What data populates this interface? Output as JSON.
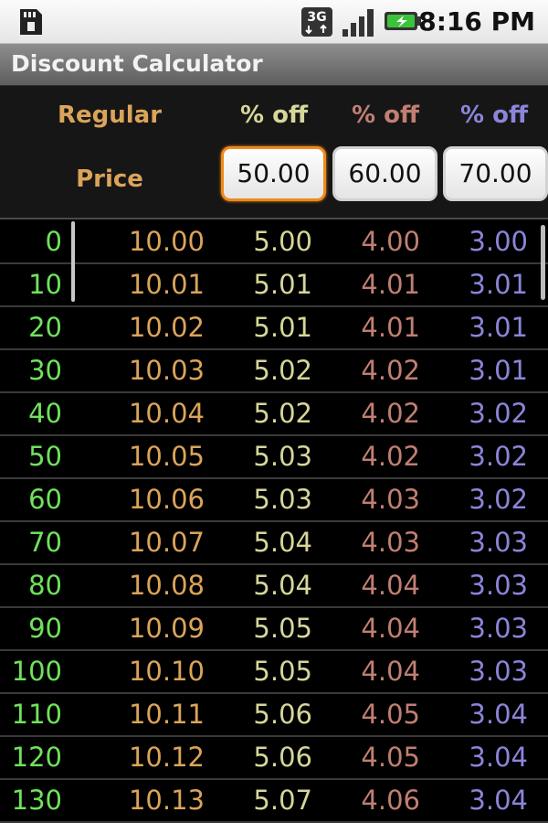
{
  "status_bar": {
    "time": "8:16 PM",
    "network": "3G",
    "icons": [
      "sd-card-icon",
      "3g-icon",
      "signal-icon",
      "battery-icon"
    ]
  },
  "app": {
    "title": "Discount Calculator"
  },
  "header": {
    "regular_label": "Regular",
    "price_label": "Price",
    "pct_labels": [
      "% off",
      "% off",
      "% off"
    ],
    "pct_values": [
      "50.00",
      "60.00",
      "70.00"
    ]
  },
  "colors": {
    "regular": "#6fe25b",
    "price": "#dba45a",
    "pct1": "#d6d69a",
    "pct2": "#c07f72",
    "pct3": "#8b85d9",
    "focus": "#f08a1a"
  },
  "rows": [
    {
      "regular": "0",
      "price": "10.00",
      "p1": "5.00",
      "p2": "4.00",
      "p3": "3.00"
    },
    {
      "regular": "10",
      "price": "10.01",
      "p1": "5.01",
      "p2": "4.01",
      "p3": "3.01"
    },
    {
      "regular": "20",
      "price": "10.02",
      "p1": "5.01",
      "p2": "4.01",
      "p3": "3.01"
    },
    {
      "regular": "30",
      "price": "10.03",
      "p1": "5.02",
      "p2": "4.02",
      "p3": "3.01"
    },
    {
      "regular": "40",
      "price": "10.04",
      "p1": "5.02",
      "p2": "4.02",
      "p3": "3.02"
    },
    {
      "regular": "50",
      "price": "10.05",
      "p1": "5.03",
      "p2": "4.02",
      "p3": "3.02"
    },
    {
      "regular": "60",
      "price": "10.06",
      "p1": "5.03",
      "p2": "4.03",
      "p3": "3.02"
    },
    {
      "regular": "70",
      "price": "10.07",
      "p1": "5.04",
      "p2": "4.03",
      "p3": "3.03"
    },
    {
      "regular": "80",
      "price": "10.08",
      "p1": "5.04",
      "p2": "4.04",
      "p3": "3.03"
    },
    {
      "regular": "90",
      "price": "10.09",
      "p1": "5.05",
      "p2": "4.04",
      "p3": "3.03"
    },
    {
      "regular": "100",
      "price": "10.10",
      "p1": "5.05",
      "p2": "4.04",
      "p3": "3.03"
    },
    {
      "regular": "110",
      "price": "10.11",
      "p1": "5.06",
      "p2": "4.05",
      "p3": "3.04"
    },
    {
      "regular": "120",
      "price": "10.12",
      "p1": "5.06",
      "p2": "4.05",
      "p3": "3.04"
    },
    {
      "regular": "130",
      "price": "10.13",
      "p1": "5.07",
      "p2": "4.06",
      "p3": "3.04"
    }
  ]
}
